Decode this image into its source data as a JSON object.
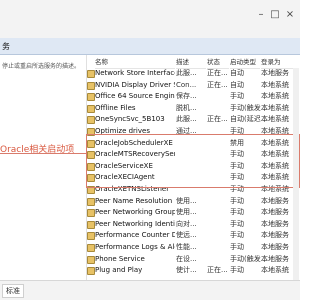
{
  "header": {
    "left_label": "务"
  },
  "left_pane": {
    "description_text": "停止或重启所选服务的描述。"
  },
  "columns": [
    "名称",
    "描述",
    "状态",
    "启动类型",
    "登录为"
  ],
  "annotation": {
    "text": "Oracle相关启动项"
  },
  "rows": [
    {
      "name": "Network Store Interface ...",
      "description": "此服...",
      "status": "正在...",
      "startup": "自动",
      "logon": "本地服务"
    },
    {
      "name": "NVIDIA Display Driver Se...",
      "description": "Con...",
      "status": "正在...",
      "startup": "自动",
      "logon": "本地系统"
    },
    {
      "name": "Office 64 Source Engine",
      "description": "保存...",
      "status": "",
      "startup": "手动",
      "logon": "本地系统"
    },
    {
      "name": "Offline Files",
      "description": "脱机...",
      "status": "",
      "startup": "手动(触发...",
      "logon": "本地系统"
    },
    {
      "name": "OneSyncSvc_5B103",
      "description": "此服...",
      "status": "正在...",
      "startup": "自动(延迟...",
      "logon": "本地系统"
    },
    {
      "name": "Optimize drives",
      "description": "通过...",
      "status": "",
      "startup": "手动",
      "logon": "本地系统"
    },
    {
      "name": "OracleJobSchedulerXE",
      "description": "",
      "status": "",
      "startup": "禁用",
      "logon": "本地系统"
    },
    {
      "name": "OracleMTSRecoveryServi...",
      "description": "",
      "status": "",
      "startup": "手动",
      "logon": "本地系统"
    },
    {
      "name": "OracleServiceXE",
      "description": "",
      "status": "",
      "startup": "手动",
      "logon": "本地系统"
    },
    {
      "name": "OracleXECIAgent",
      "description": "",
      "status": "",
      "startup": "手动",
      "logon": "本地系统"
    },
    {
      "name": "OracleXETNSListener",
      "description": "",
      "status": "",
      "startup": "手动",
      "logon": "本地系统"
    },
    {
      "name": "Peer Name Resolution Pr...",
      "description": "使用...",
      "status": "",
      "startup": "手动",
      "logon": "本地服务"
    },
    {
      "name": "Peer Networking Groupi...",
      "description": "使用...",
      "status": "",
      "startup": "手动",
      "logon": "本地服务"
    },
    {
      "name": "Peer Networking Identity...",
      "description": "向对...",
      "status": "",
      "startup": "手动",
      "logon": "本地服务"
    },
    {
      "name": "Performance Counter DL...",
      "description": "使远...",
      "status": "",
      "startup": "手动",
      "logon": "本地服务"
    },
    {
      "name": "Performance Logs & Aler...",
      "description": "性能...",
      "status": "",
      "startup": "手动",
      "logon": "本地服务"
    },
    {
      "name": "Phone Service",
      "description": "在设...",
      "status": "",
      "startup": "手动(触发...",
      "logon": "本地服务"
    },
    {
      "name": "Plug and Play",
      "description": "使计...",
      "status": "正在...",
      "startup": "手动",
      "logon": "本地系统"
    }
  ],
  "bottom": {
    "tab_label": "标准"
  }
}
